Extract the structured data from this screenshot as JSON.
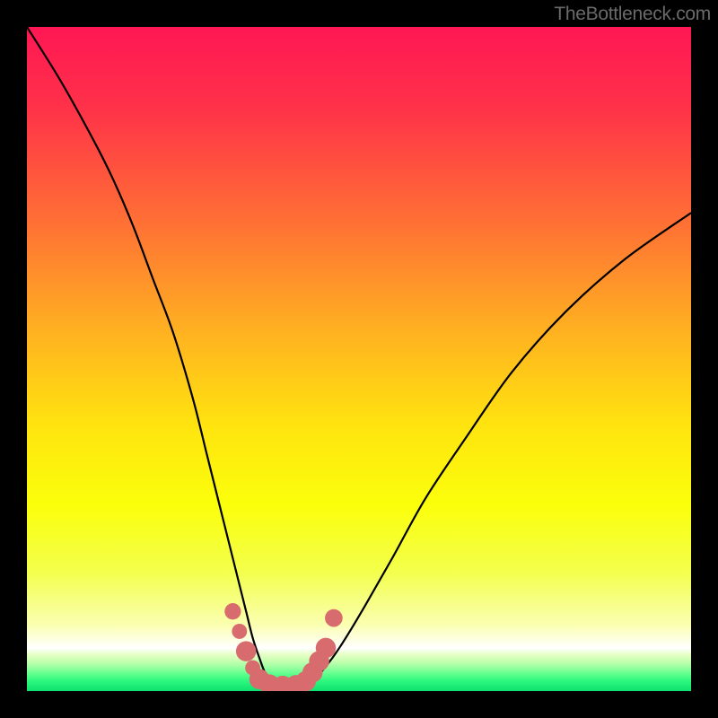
{
  "watermark": "TheBottleneck.com",
  "chart_data": {
    "type": "line",
    "title": "",
    "xlabel": "",
    "ylabel": "",
    "xlim": [
      0,
      100
    ],
    "ylim": [
      0,
      100
    ],
    "series": [
      {
        "name": "bottleneck-curve",
        "x": [
          0,
          5,
          10,
          13,
          16,
          19,
          22,
          25,
          27,
          29,
          31,
          33,
          34,
          35,
          36,
          37.5,
          40,
          42.5,
          44,
          46,
          48,
          51,
          55,
          60,
          66,
          73,
          81,
          90,
          100
        ],
        "values": [
          100,
          92,
          83,
          77,
          70,
          62,
          54,
          44,
          36,
          28,
          20,
          12,
          8,
          5,
          2.5,
          1.0,
          0.5,
          1.0,
          2.5,
          5,
          8,
          13,
          20,
          29,
          38,
          48,
          57,
          65,
          72
        ]
      }
    ],
    "markers": {
      "name": "highlight-dots",
      "color": "#d86b6e",
      "points": [
        {
          "x": 31.0,
          "y": 12.0,
          "r": 1.3
        },
        {
          "x": 32.0,
          "y": 9.0,
          "r": 1.2
        },
        {
          "x": 33.0,
          "y": 6.0,
          "r": 1.6
        },
        {
          "x": 34.0,
          "y": 3.5,
          "r": 1.2
        },
        {
          "x": 35.0,
          "y": 1.8,
          "r": 1.6
        },
        {
          "x": 36.5,
          "y": 1.0,
          "r": 1.6
        },
        {
          "x": 38.5,
          "y": 0.8,
          "r": 1.6
        },
        {
          "x": 40.5,
          "y": 0.9,
          "r": 1.6
        },
        {
          "x": 42.0,
          "y": 1.5,
          "r": 1.6
        },
        {
          "x": 43.0,
          "y": 2.8,
          "r": 1.6
        },
        {
          "x": 44.0,
          "y": 4.5,
          "r": 1.6
        },
        {
          "x": 45.0,
          "y": 6.5,
          "r": 1.6
        },
        {
          "x": 46.2,
          "y": 11.0,
          "r": 1.4
        }
      ]
    },
    "gradient_stops": [
      {
        "pos": 0.0,
        "color": "#ff1754"
      },
      {
        "pos": 0.12,
        "color": "#ff3149"
      },
      {
        "pos": 0.3,
        "color": "#ff7234"
      },
      {
        "pos": 0.45,
        "color": "#ffae22"
      },
      {
        "pos": 0.6,
        "color": "#ffe40f"
      },
      {
        "pos": 0.72,
        "color": "#fbff0b"
      },
      {
        "pos": 0.82,
        "color": "#f3ff4c"
      },
      {
        "pos": 0.9,
        "color": "#faffb0"
      },
      {
        "pos": 0.935,
        "color": "#ffffff"
      },
      {
        "pos": 0.945,
        "color": "#e6ffc6"
      },
      {
        "pos": 0.955,
        "color": "#c6ffb0"
      },
      {
        "pos": 0.965,
        "color": "#96ff9f"
      },
      {
        "pos": 0.975,
        "color": "#5cff8c"
      },
      {
        "pos": 0.985,
        "color": "#2cf77e"
      },
      {
        "pos": 1.0,
        "color": "#0de26f"
      }
    ]
  }
}
